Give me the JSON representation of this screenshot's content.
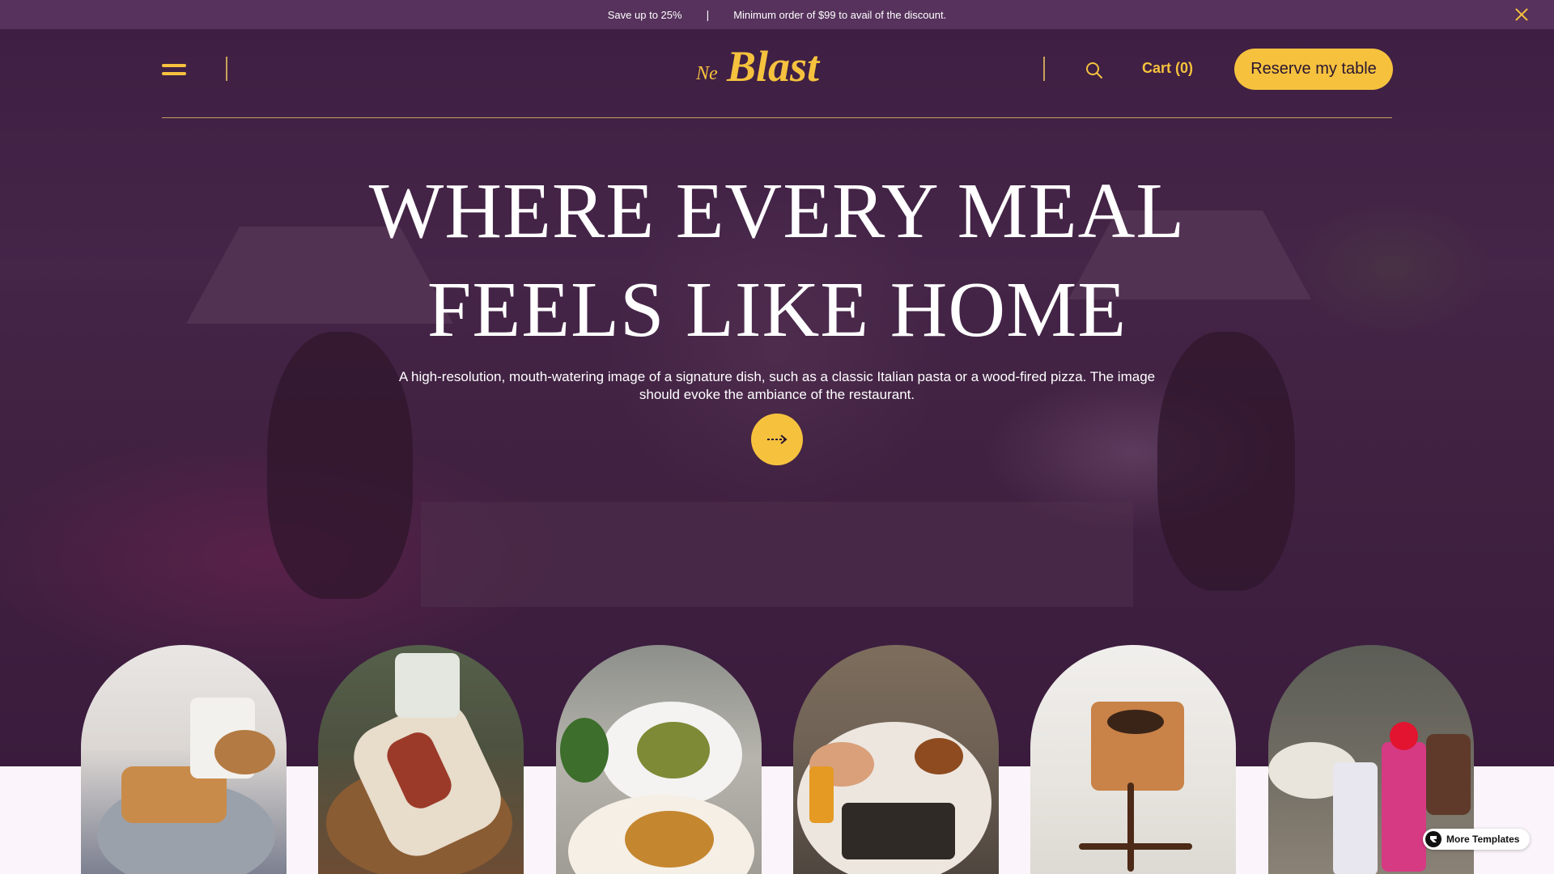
{
  "promo": {
    "message": "Save up to 25%",
    "separator": "|",
    "detail": "Minimum order of $99 to avail of the discount."
  },
  "header": {
    "logo_prefix": "Ne",
    "logo_text": "Blast",
    "cart_label": "Cart (0)",
    "reserve_label": "Reserve my table"
  },
  "hero": {
    "headline_line1": "WHERE EVERY MEAL",
    "headline_line2": "FEELS LIKE HOME",
    "subtext": "A high-resolution, mouth-watering image of a signature dish, such as a classic Italian pasta or a wood-fired pizza. The image should evoke the ambiance of the restaurant."
  },
  "dishes": [
    {
      "name": "breakfast-toast-plate"
    },
    {
      "name": "chicken-wrap"
    },
    {
      "name": "salad-and-grilled-chicken"
    },
    {
      "name": "table-spread-meal"
    },
    {
      "name": "layered-honey-cake"
    },
    {
      "name": "cocktails-and-desserts"
    }
  ],
  "badge": {
    "label": "More Templates"
  },
  "colors": {
    "accent": "#f6c23e",
    "promo_bg": "#56325c",
    "page_bg": "#fbf5fb"
  },
  "icons": [
    "menu-icon",
    "search-icon",
    "close-icon",
    "arrow-right-icon",
    "framer-icon"
  ]
}
